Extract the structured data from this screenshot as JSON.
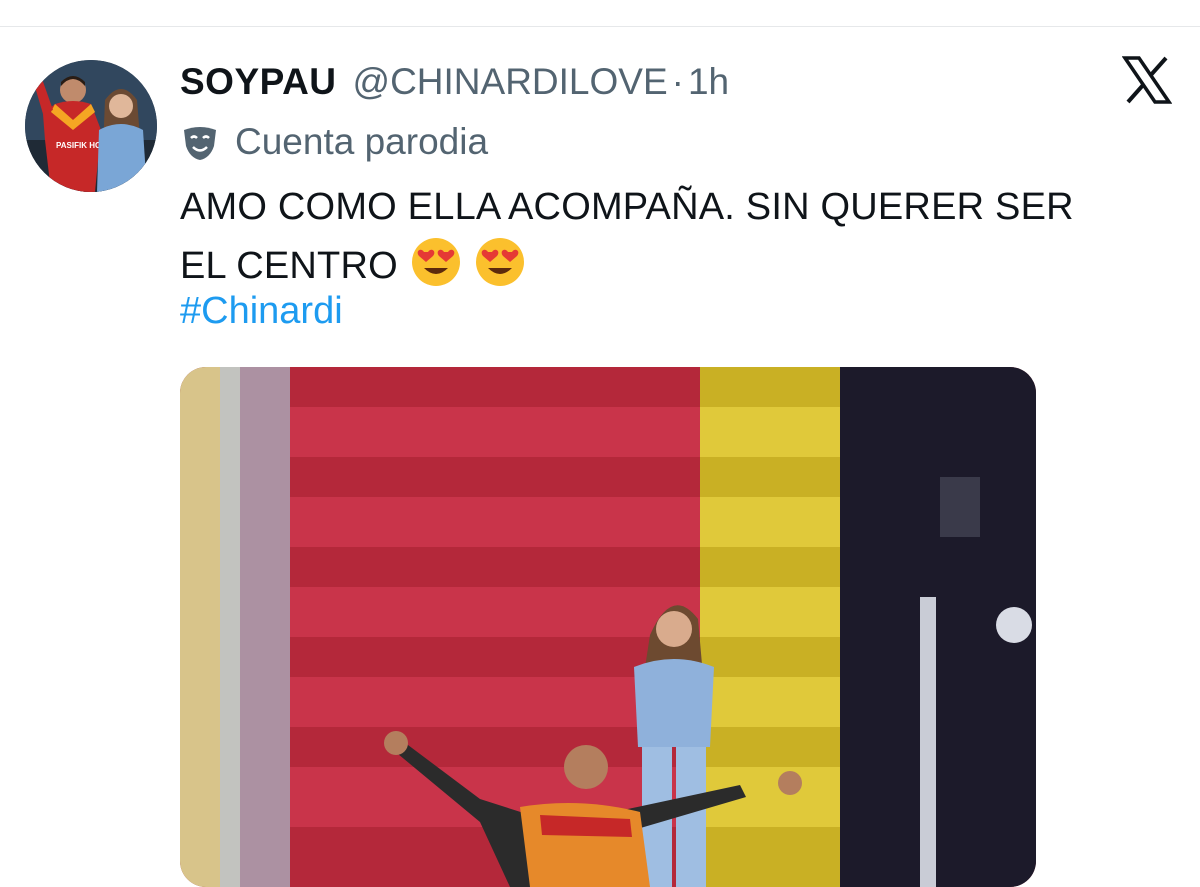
{
  "tweet": {
    "display_name": "SOYPAU",
    "handle": "@CHINARDILOVE",
    "separator": "·",
    "time": "1h",
    "parody_label": "Cuenta parodia",
    "text_line_1": "AMO COMO ELLA ACOMPAÑA. SIN QUERER SER",
    "text_line_2": "EL CENTRO",
    "emojis": [
      "smiling-face-with-heart-eyes",
      "smiling-face-with-heart-eyes"
    ],
    "hashtag": "#Chinardi",
    "media_type": "video-thumbnail"
  },
  "avatar_banner_text": "PASIFIK HOLDING",
  "icons": {
    "platform_logo": "x-logo-icon",
    "parody": "theater-mask-icon"
  },
  "colors": {
    "hashtag": "#1d9bf0",
    "secondary_text": "#536471",
    "primary_text": "#0f1419",
    "divider": "#e6e8ea"
  }
}
